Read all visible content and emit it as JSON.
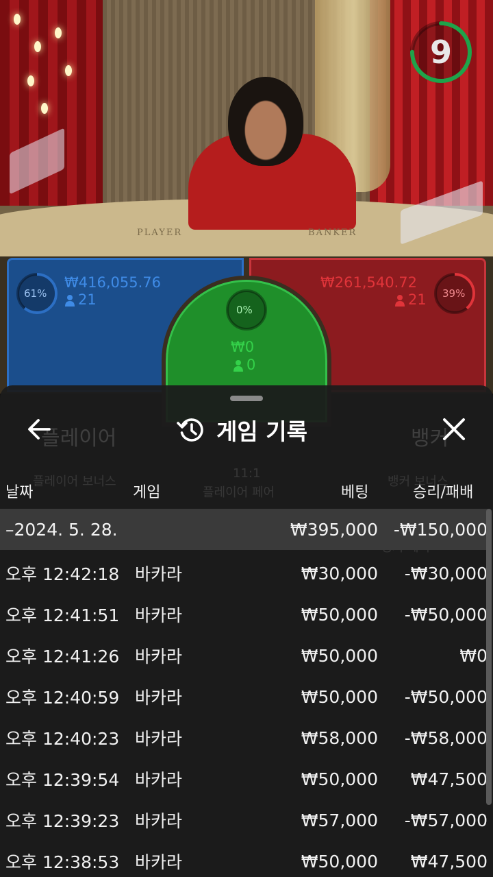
{
  "timer": {
    "value": "9",
    "progress": 0.75,
    "color": "#1fa34a"
  },
  "table_labels": {
    "player": "PLAYER",
    "banker": "BANKER"
  },
  "bets": {
    "player": {
      "percent": "61%",
      "amount": "₩416,055.76",
      "players": "21",
      "progress": 0.61,
      "color": "#2c6fc4"
    },
    "banker": {
      "percent": "39%",
      "amount": "₩261,540.72",
      "players": "21",
      "progress": 0.39,
      "color": "#c8353b"
    },
    "tie": {
      "percent": "0%",
      "amount": "₩0",
      "players": "0",
      "color": "#34c04a"
    }
  },
  "background_ghosts": {
    "player": "플레이어",
    "banker": "뱅커",
    "player_bonus": "플레이어 보너스",
    "player_pair_ratio": "11:1",
    "player_pair": "플레이어 페어",
    "banker_bonus": "뱅커 보너스",
    "banker_pair": "뱅커 페어"
  },
  "sheet": {
    "title": "게임 기록",
    "columns": {
      "date": "날짜",
      "game": "게임",
      "bet": "베팅",
      "result": "승리/패배"
    },
    "summary": {
      "date": "–2024. 5. 28.",
      "bet": "₩395,000",
      "result": "-₩150,000"
    },
    "rows": [
      {
        "time": "오후 12:42:18",
        "game": "바카라",
        "bet": "₩30,000",
        "result": "-₩30,000"
      },
      {
        "time": "오후 12:41:51",
        "game": "바카라",
        "bet": "₩50,000",
        "result": "-₩50,000"
      },
      {
        "time": "오후 12:41:26",
        "game": "바카라",
        "bet": "₩50,000",
        "result": "₩0"
      },
      {
        "time": "오후 12:40:59",
        "game": "바카라",
        "bet": "₩50,000",
        "result": "-₩50,000"
      },
      {
        "time": "오후 12:40:23",
        "game": "바카라",
        "bet": "₩58,000",
        "result": "-₩58,000"
      },
      {
        "time": "오후 12:39:54",
        "game": "바카라",
        "bet": "₩50,000",
        "result": "₩47,500"
      },
      {
        "time": "오후 12:39:23",
        "game": "바카라",
        "bet": "₩57,000",
        "result": "-₩57,000"
      },
      {
        "time": "오후 12:38:53",
        "game": "바카라",
        "bet": "₩50,000",
        "result": "₩47,500"
      }
    ]
  }
}
